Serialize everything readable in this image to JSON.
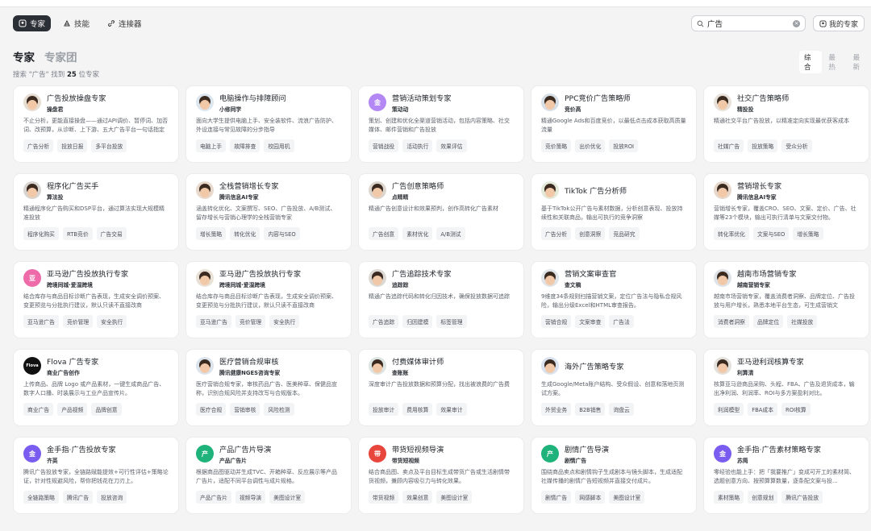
{
  "nav": {
    "tabs": [
      {
        "label": "专家",
        "icon": "expert-icon",
        "active": true
      },
      {
        "label": "技能",
        "icon": "skill-icon",
        "active": false
      },
      {
        "label": "连接器",
        "icon": "link-icon",
        "active": false
      }
    ],
    "search_value": "广告",
    "my_experts_label": "我的专家"
  },
  "heading": {
    "main": "专家",
    "sub": "专家团"
  },
  "sort": {
    "options": [
      "综合",
      "最热",
      "最新"
    ],
    "active": "综合"
  },
  "result": {
    "prefix": "搜索 \"广告\" 找到",
    "count": "25",
    "suffix": "位专家"
  },
  "colors": {
    "accent_dark": "#2b2f36",
    "purple": "#7b5cf0",
    "pink": "#e85ba0",
    "green": "#1fb27a",
    "red": "#e8453c"
  },
  "cards": [
    {
      "title": "广告投放操盘专家",
      "sub": "操盘君",
      "desc": "不止分析，更能直接操盘——通过API调价、暂停词、加否词、改预算，从诊断、上下游、五大广告平台一句话指定",
      "tags": [
        "广告分析",
        "投放日报",
        "多平台投放"
      ],
      "avatar": "photo",
      "avatar_color": "#e6ddd2"
    },
    {
      "title": "电脑操作与排障顾问",
      "sub": "小修同学",
      "desc": "面向大学生提供电脑上手、安全装软件、流浪广告防护、外设连接与常见故障的分步指导",
      "tags": [
        "电脑上手",
        "故障排查",
        "校园用机"
      ],
      "avatar": "photo",
      "avatar_color": "#dbe6ef"
    },
    {
      "title": "营销活动策划专家",
      "sub": "策动动",
      "desc": "策划、创建和优化全渠道营销活动，包括内容策略、社交媒体、邮件营销和广告投放",
      "tags": [
        "营销战役",
        "活动执行",
        "效果评估"
      ],
      "avatar": "purple",
      "avatar_color": "#b388f5"
    },
    {
      "title": "PPC竞价广告策略师",
      "sub": "竞价高",
      "desc": "精通Google Ads和百度竞价，以最低点击成本获取高质量流量",
      "tags": [
        "竞价策略",
        "出价优化",
        "投放ROI"
      ],
      "avatar": "photo",
      "avatar_color": "#d6dee6"
    },
    {
      "title": "社交广告策略师",
      "sub": "精投投",
      "desc": "精通社交平台广告投放，以精准定向实现最优获客成本",
      "tags": [
        "社媒广告",
        "投放策略",
        "受众分析"
      ],
      "avatar": "photo",
      "avatar_color": "#e7e1da"
    },
    {
      "title": "程序化广告买手",
      "sub": "算法投",
      "desc": "精通程序化广告购买和DSP平台，通过算法实现大规模精准投放",
      "tags": [
        "程序化购买",
        "RTB竞价",
        "广告交易"
      ],
      "avatar": "photo",
      "avatar_color": "#d9d4cf"
    },
    {
      "title": "全栈营销增长专家",
      "sub": "腾讯信息AI专家",
      "desc": "涵盖转化优化、文案撰写、SEO、广告投放、A/B测试、留存增长与营销心理学的全栈营销专家",
      "tags": [
        "增长策略",
        "转化优化",
        "内容与SEO"
      ],
      "avatar": "photo",
      "avatar_color": "#e8d9cc"
    },
    {
      "title": "广告创意策略师",
      "sub": "点睛睛",
      "desc": "精通广告创意设计和效果预判，创作高转化广告素材",
      "tags": [
        "广告创意",
        "素材优化",
        "A/B测试"
      ],
      "avatar": "photo",
      "avatar_color": "#ddd6cf"
    },
    {
      "title": "TikTok 广告分析师",
      "sub": "",
      "desc": "基于TikTok公开广告与素材数据，分析创意表现、投放持续性和关联商品，输出可执行的竞争洞察",
      "tags": [
        "广告分析",
        "创意洞察",
        "竞品研究"
      ],
      "avatar": "photo",
      "avatar_color": "#e3e9d8"
    },
    {
      "title": "营销增长专家",
      "sub": "腾讯信息AI专家",
      "desc": "营销增长专家，覆盖CRO、SEO、文案、定价、广告、社媒等23个模块，输出可执行清单与文案交付物。",
      "tags": [
        "转化率优化",
        "文案与SEO",
        "增长策略"
      ],
      "avatar": "photo",
      "avatar_color": "#e6d8cc"
    },
    {
      "title": "亚马逊广告投放执行专家",
      "sub": "跨境同城·爱湿跨境",
      "desc": "结合库存与商品目标诊断广告表现，生成安全调价预案、变更预览与分批执行建议，默认只读不直接改商",
      "tags": [
        "亚马逊广告",
        "竞价管理",
        "安全执行"
      ],
      "avatar": "pink",
      "avatar_color": "#ef6aa8"
    },
    {
      "title": "亚马逊广告投放执行专家",
      "sub": "跨境同城·爱湿跨境",
      "desc": "结合库存与商品目标诊断广告表现，生成安全调价预案、变更预览与分批执行建议，默认只读不直接改商",
      "tags": [
        "亚马逊广告",
        "竞价管理",
        "安全执行"
      ],
      "avatar": "photo",
      "avatar_color": "#e9e1d6"
    },
    {
      "title": "广告追踪技术专家",
      "sub": "追踪踪",
      "desc": "精通广告追踪代码和转化归因技术，确保投放数据可追踪",
      "tags": [
        "广告追踪",
        "归因建模",
        "标签管理"
      ],
      "avatar": "photo",
      "avatar_color": "#dcd8d4"
    },
    {
      "title": "营销文案审查官",
      "sub": "查文稿",
      "desc": "9维度34条规则扫描营销文案，定位广告法与隐私合规风险，输出分级Excel和HTML审查报告。",
      "tags": [
        "营销合规",
        "文案审查",
        "广告法"
      ],
      "avatar": "photo",
      "avatar_color": "#dfe4e8"
    },
    {
      "title": "越南市场营销专家",
      "sub": "越南营销专家",
      "desc": "越南市场营销专家，覆盖消费者洞察、品牌定位、广告投放与用户增长，熟悉本地平台生态，可生成营销文",
      "tags": [
        "消费者洞察",
        "品牌定位",
        "社媒投放"
      ],
      "avatar": "photo",
      "avatar_color": "#dfe2e6"
    },
    {
      "title": "Flova 广告专家",
      "sub": "商业广告创作",
      "desc": "上传商品、品牌 Logo 或产品素材，一键生成商品广告、数字人口播、时装展示与工业产品宣传片。",
      "tags": [
        "商业广告",
        "产品视频",
        "品牌创意"
      ],
      "avatar": "flova",
      "avatar_color": "#111111"
    },
    {
      "title": "医疗营销合规审核",
      "sub": "腾讯健康NGES咨询专家",
      "desc": "医疗营销合规专家，审核药品广告、医美种草、保健品宣称，识别合规风险并支持改写与合规版本。",
      "tags": [
        "医疗合规",
        "营销审核",
        "风险检测"
      ],
      "avatar": "photo",
      "avatar_color": "#dbe3ec"
    },
    {
      "title": "付费媒体审计师",
      "sub": "查账账",
      "desc": "深度审计广告投放数据和预算分配，找出被浪费的广告费",
      "tags": [
        "投放审计",
        "费用核算",
        "效果审计"
      ],
      "avatar": "photo",
      "avatar_color": "#dde5e2"
    },
    {
      "title": "海外广告策略专家",
      "sub": "",
      "desc": "生成Google/Meta账户结构、受众假设、创意和落地页测试方案。",
      "tags": [
        "外贸业务",
        "B2B销售",
        "询盘云"
      ],
      "avatar": "photo",
      "avatar_color": "#d9e2ee"
    },
    {
      "title": "亚马逊利润核算专家",
      "sub": "利算清",
      "desc": "核算亚马逊商品采购、头程、FBA、广告及退货成本，输出净利润、利润率、ROI与多方案盈利对比。",
      "tags": [
        "利润模型",
        "FBA成本",
        "ROI核算"
      ],
      "avatar": "photo",
      "avatar_color": "#e4e0dc"
    },
    {
      "title": "金手指·广告投放专家",
      "sub": "齐英",
      "desc": "腾讯广告投放专家，全链路赋能提效+可行性评估+策略论证，针对性规避风险，帮你把钱花在刀刃上。",
      "tags": [
        "全链路策略",
        "腾讯广告",
        "投放咨询"
      ],
      "avatar": "purple",
      "avatar_color": "#7b5cf0"
    },
    {
      "title": "产品广告片导演",
      "sub": "产品广告片",
      "desc": "根据商品图驱动并生成TVC、开箱种草、反应展示等产品广告片，适配不同平台调性与成片规格。",
      "tags": [
        "产品广告片",
        "视频导演",
        "美图设计室"
      ],
      "avatar": "green",
      "avatar_color": "#1fb27a"
    },
    {
      "title": "带货短视频导演",
      "sub": "带货短视频",
      "desc": "结合商品图、卖点及平台目标生成带货广告或生活剧情带货视频，兼顾内容吸引力与转化效果。",
      "tags": [
        "带货视频",
        "效果创意",
        "美图设计室"
      ],
      "avatar": "red",
      "avatar_color": "#e8453c"
    },
    {
      "title": "剧情广告导演",
      "sub": "剧情广告",
      "desc": "围绕商品卖点和剧情钩子生成剧本与镜头脚本，生成适配社媒传播的剧情广告短视频并直接交付成片。",
      "tags": [
        "剧情广告",
        "网感脚本",
        "美图设计室"
      ],
      "avatar": "green",
      "avatar_color": "#1fb27a"
    },
    {
      "title": "金手指·广告素材策略专家",
      "sub": "苏简",
      "desc": "零经验也能上手：把「我要推广」变成可开工的素材简、选题创意方向、按预算算数量，逐条配文案与投...",
      "tags": [
        "素材策略",
        "创意规划",
        "腾讯广告投放"
      ],
      "avatar": "purple",
      "avatar_color": "#7b5cf0"
    }
  ]
}
